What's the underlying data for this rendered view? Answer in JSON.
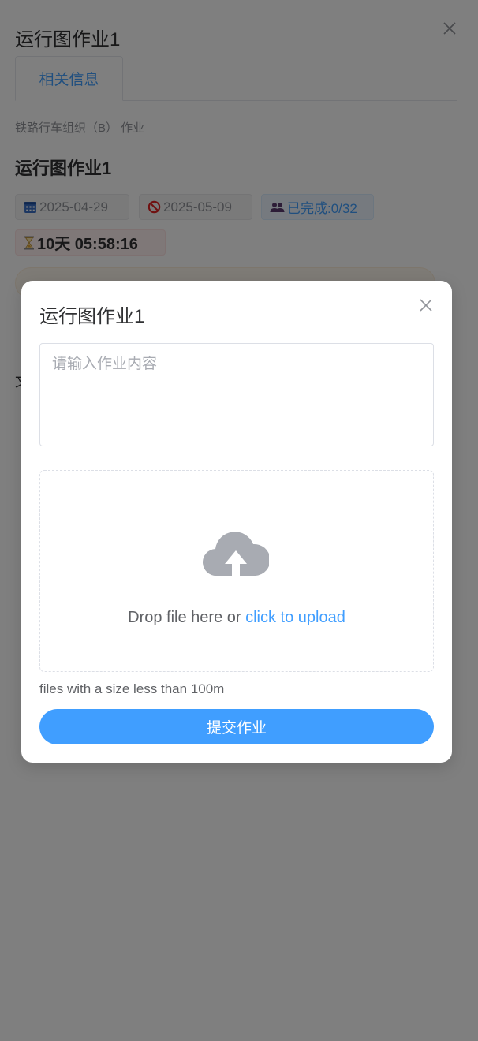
{
  "drawer": {
    "title": "运行图作业1",
    "tabs": [
      {
        "label": "相关信息"
      }
    ],
    "course": "铁路行车组织（B） 作业",
    "homework_title": "运行图作业1",
    "start_date": "2025-04-29",
    "end_date": "2025-05-09",
    "completed": "已完成:0/32",
    "countdown": "10天 05:58:16",
    "partial_char": "文"
  },
  "dialog": {
    "title": "运行图作业1",
    "textarea_placeholder": "请输入作业内容",
    "upload": {
      "icon": "cloud-upload-icon",
      "drop_text": "Drop file here or ",
      "click_text": "click to upload"
    },
    "tip": "files with a size less than 100m",
    "submit_label": "提交作业"
  },
  "colors": {
    "primary": "#409eff",
    "overlay": "rgba(0,0,0,0.5)",
    "upload_icon": "#a8abb2"
  }
}
